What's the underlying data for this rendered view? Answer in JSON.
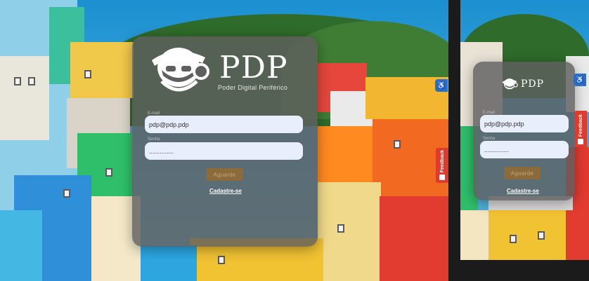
{
  "brand": {
    "name": "PDP",
    "tagline": "Poder Digital Periférico"
  },
  "login": {
    "email_label": "E-mail",
    "email_value": "pdp@pdp.pdp",
    "password_label": "Senha",
    "password_value": "..............",
    "submit_label": "Aguarde",
    "signup_link": "Cadastre-se"
  },
  "feedback": {
    "label": "Feedback",
    "color": "#e03a2c"
  },
  "accessibility": {
    "icon": "accessibility-icon",
    "color": "#2a6fc0"
  },
  "icons": {
    "logo": "user-headphones-logo-icon",
    "feedback": "feedback-icon"
  }
}
